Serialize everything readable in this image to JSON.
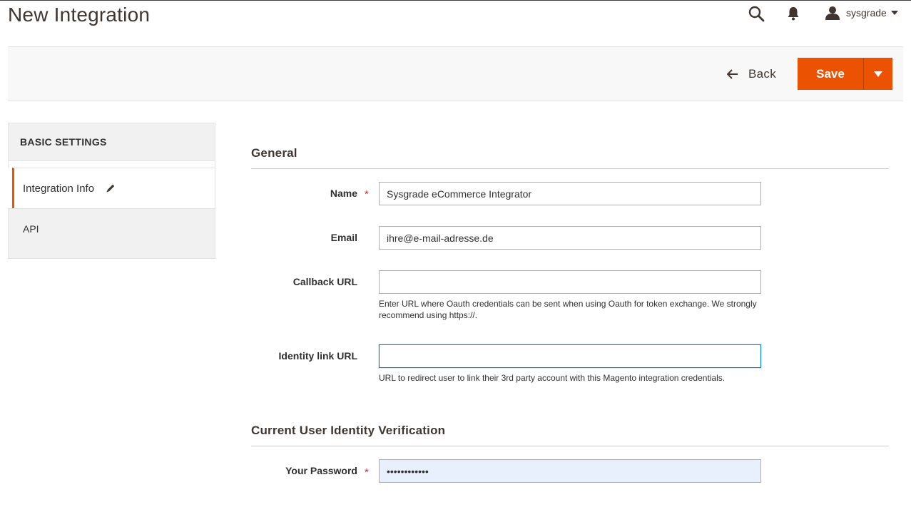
{
  "header": {
    "page_title": "New Integration",
    "user_name": "sysgrade"
  },
  "action_bar": {
    "back_label": "Back",
    "save_label": "Save"
  },
  "sidebar": {
    "heading": "BASIC SETTINGS",
    "items": [
      {
        "label": "Integration Info",
        "active": true
      },
      {
        "label": "API",
        "active": false
      }
    ]
  },
  "sections": {
    "general_title": "General",
    "verification_title": "Current User Identity Verification"
  },
  "fields": {
    "name": {
      "label": "Name",
      "value": "Sysgrade eCommerce Integrator",
      "required": "*"
    },
    "email": {
      "label": "Email",
      "value": "ihre@e-mail-adresse.de"
    },
    "callback_url": {
      "label": "Callback URL",
      "value": "",
      "note": "Enter URL where Oauth credentials can be sent when using Oauth for token exchange. We strongly recommend using https://."
    },
    "identity_link_url": {
      "label": "Identity link URL",
      "value": "",
      "note": "URL to redirect user to link their 3rd party account with this Magento integration credentials."
    },
    "password": {
      "label": "Your Password",
      "value": "••••••••••••",
      "required": "*"
    }
  },
  "colors": {
    "accent": "#eb5202",
    "required": "#e22626",
    "focus": "#007bdb"
  }
}
